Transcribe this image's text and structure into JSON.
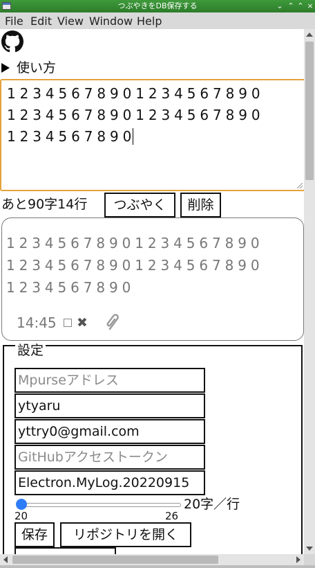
{
  "window": {
    "title": "つぶやきをDB保存する",
    "controls": [
      "⌄",
      "⌃",
      "⌃",
      "×"
    ]
  },
  "menu": [
    "File",
    "Edit",
    "View",
    "Window",
    "Help"
  ],
  "howto": {
    "label": "使い方"
  },
  "editor": {
    "value": "1234567890123456789012345678901234567890 1234567890"
  },
  "editor_lines": [
    "12345678901234567890",
    "12345678901234567890",
    "1234567890"
  ],
  "counter": "あと90字14行",
  "buttons": {
    "tweet": "つぶやく",
    "delete": "削除",
    "save": "保存",
    "open_repo": "リポジトリを開く"
  },
  "card": {
    "lines": [
      "12345678901234567890",
      "12345678901234567890",
      "1234567890"
    ],
    "time": "14:45",
    "delete_symbol": "✖"
  },
  "settings": {
    "legend": "設定",
    "mpurse_placeholder": "Mpurseアドレス",
    "username": "ytyaru",
    "email": "yttry0@gmail.com",
    "token_placeholder": "GitHubアクセストークン",
    "repo": "Electron.MyLog.20220915",
    "slider": {
      "value": 20,
      "min": "20",
      "max": "26",
      "label": "20字／行"
    }
  },
  "icons": {
    "github": "github-icon",
    "clip": "paperclip-icon"
  }
}
